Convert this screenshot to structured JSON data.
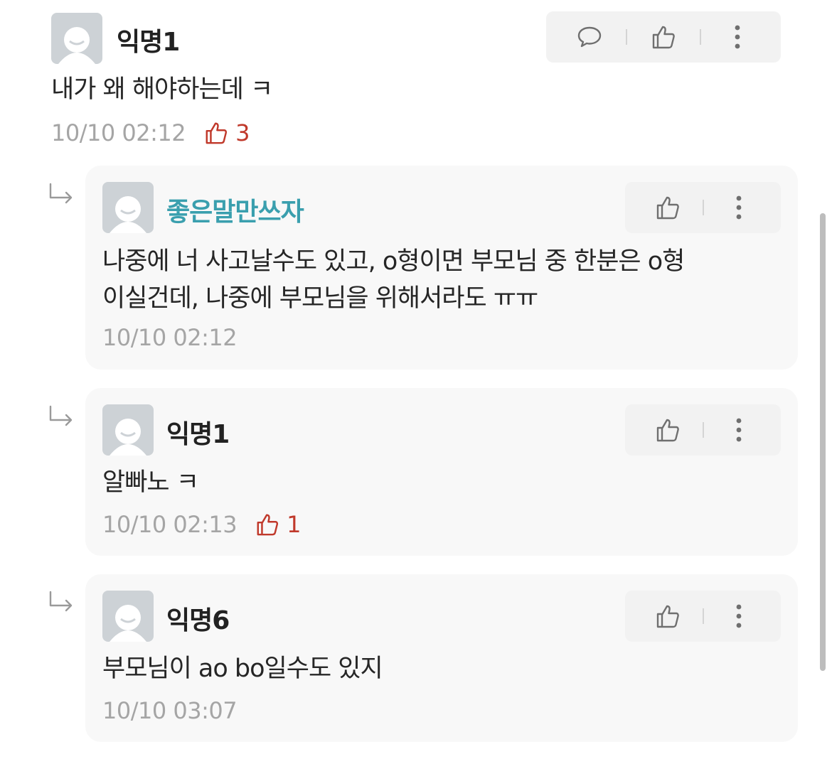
{
  "comments": [
    {
      "author": "익명1",
      "text_lines": [
        "내가 왜 해야하는데 ㅋ"
      ],
      "time": "10/10 02:12",
      "likes": "3",
      "actions": [
        "comment-icon",
        "thumbs-up-icon",
        "more-icon"
      ]
    }
  ],
  "replies": [
    {
      "author": "좋은말만쓰자",
      "author_color": "#3a9fae",
      "text_lines": [
        "나중에 너 사고날수도 있고, o형이면 부모님 중 한분은 o형",
        "이실건데, 나중에 부모님을 위해서라도 ㅠㅠ"
      ],
      "time": "10/10 02:12",
      "likes": null,
      "actions": [
        "thumbs-up-icon",
        "more-icon"
      ]
    },
    {
      "author": "익명1",
      "author_color": "#222222",
      "text_lines": [
        "알빠노 ㅋ"
      ],
      "time": "10/10 02:13",
      "likes": "1",
      "actions": [
        "thumbs-up-icon",
        "more-icon"
      ]
    },
    {
      "author": "익명6",
      "author_color": "#222222",
      "text_lines": [
        "부모님이 ao bo일수도 있지"
      ],
      "time": "10/10 03:07",
      "likes": null,
      "actions": [
        "thumbs-up-icon",
        "more-icon"
      ]
    }
  ],
  "colors": {
    "like_red": "#c0392b",
    "teal_author": "#3a9fae",
    "meta_gray": "#a5a5a5"
  }
}
